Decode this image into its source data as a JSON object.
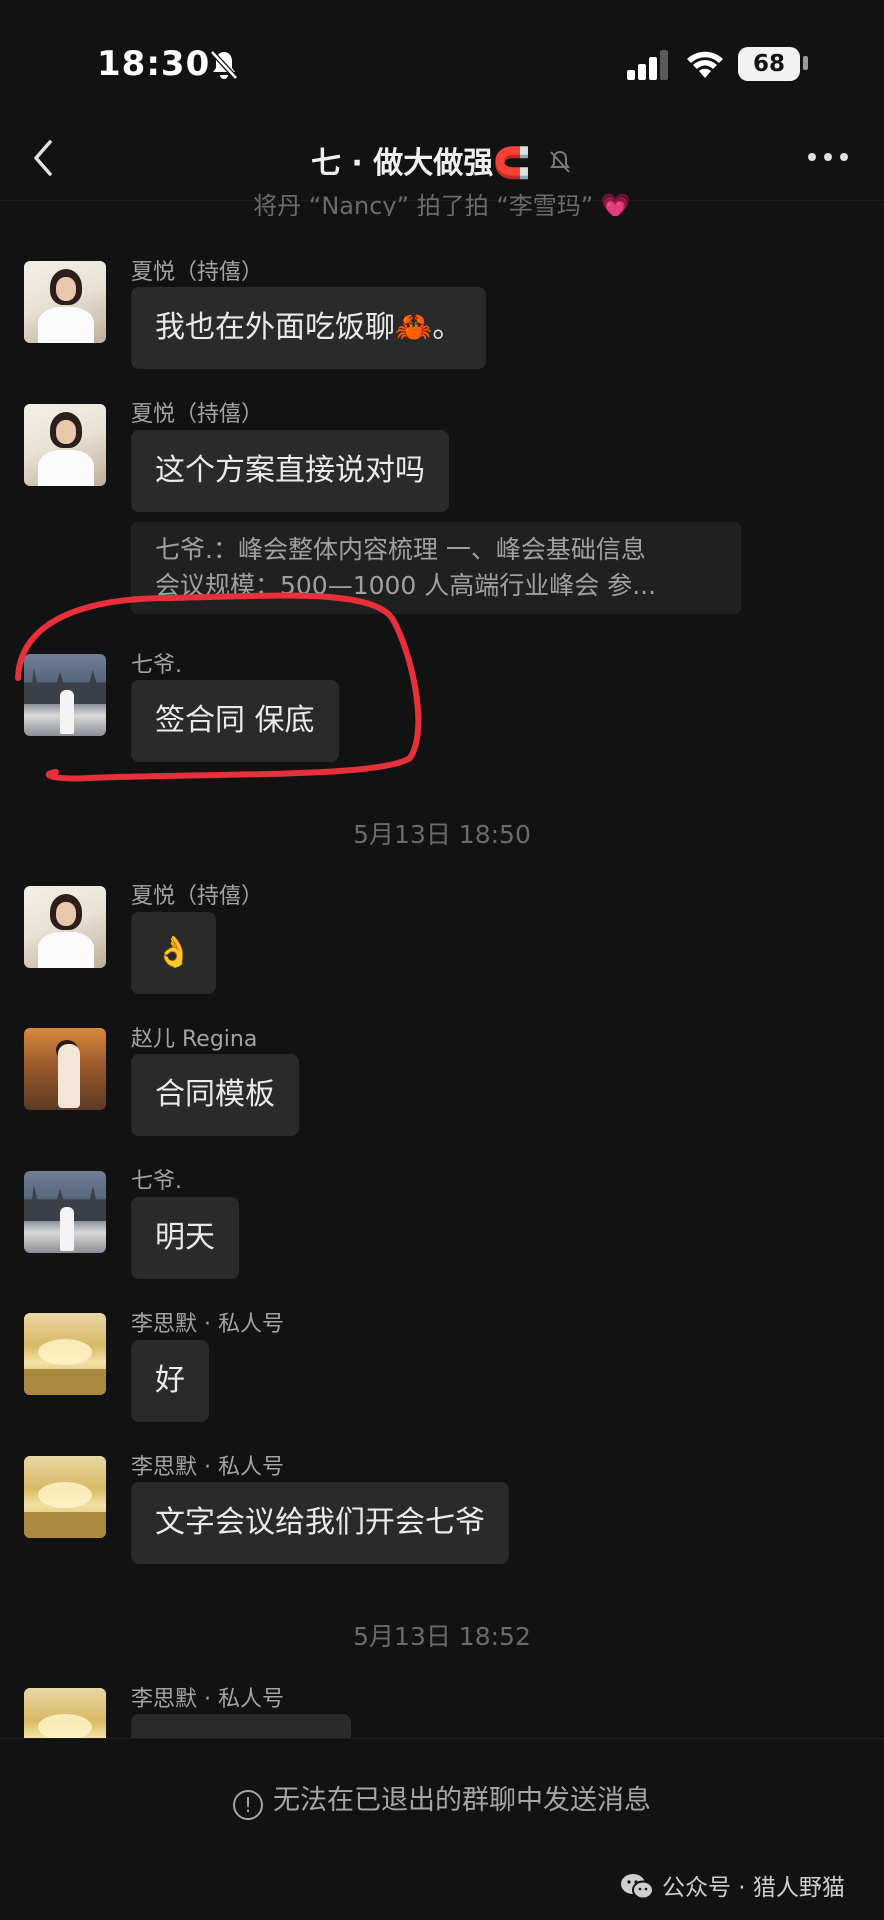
{
  "status_bar": {
    "time": "18:30",
    "battery": "68"
  },
  "nav": {
    "title": "七 · 做大做强🧲"
  },
  "system_partial": "将丹 “Nancy” 拍了拍 “李雪玛” 💗",
  "messages": [
    {
      "sender": "夏悦（持僖）",
      "text": "我也在外面吃饭聊🦀。"
    },
    {
      "sender": "夏悦（持僖）",
      "text": "这个方案直接说对吗",
      "quote_line1": "七爷.：峰会整体内容梳理  一、峰会基础信息",
      "quote_line2": "会议规模：500—1000 人高端行业峰会  参..."
    },
    {
      "sender": "七爷.",
      "text": "签合同 保底"
    },
    {
      "sender": "夏悦（持僖）",
      "text": "👌"
    },
    {
      "sender": "赵儿 Regina",
      "text": "合同模板"
    },
    {
      "sender": "七爷.",
      "text": "明天"
    },
    {
      "sender": "李思默 · 私人号",
      "text": "好"
    },
    {
      "sender": "李思默 · 私人号",
      "text": "文字会议给我们开会七爷"
    },
    {
      "sender": "李思默 · 私人号",
      "text": ""
    }
  ],
  "timestamps": [
    "5月13日 18:50",
    "5月13日 18:52"
  ],
  "footer": {
    "notice": "无法在已退出的群聊中发送消息",
    "watermark": "公众号 · 猎人野猫"
  },
  "colors": {
    "background": "#121212",
    "bubble": "#2a2a2a",
    "annotation": "#e8303a"
  },
  "icons": [
    "bell-off-icon",
    "signal-icon",
    "wifi-icon",
    "battery-icon",
    "back-arrow-icon",
    "more-icon",
    "info-icon",
    "wechat-icon"
  ]
}
